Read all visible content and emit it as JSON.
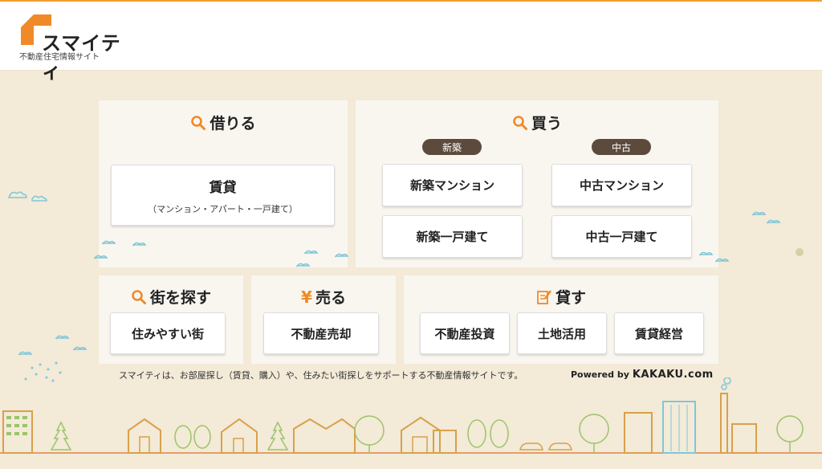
{
  "header": {
    "logo_name": "スマイティ",
    "logo_sub": "不動産住宅情報サイト"
  },
  "rent": {
    "title": "借りる",
    "button_label": "賃貸",
    "button_sub": "（マンション・アパート・一戸建て）"
  },
  "buy": {
    "title": "買う",
    "new_pill": "新築",
    "used_pill": "中古",
    "new_mansion": "新築マンション",
    "new_house": "新築一戸建て",
    "used_mansion": "中古マンション",
    "used_house": "中古一戸建て"
  },
  "town": {
    "title": "街を探す",
    "button": "住みやすい街"
  },
  "sell": {
    "title": "売る",
    "icon_glyph": "¥",
    "button": "不動産売却"
  },
  "lend": {
    "title": "貸す",
    "invest": "不動産投資",
    "land": "土地活用",
    "manage": "賃貸経営"
  },
  "footer": {
    "description": "スマイティは、お部屋探し（賃貸、購入）や、住みたい街探しをサポートする不動産情報サイトです。",
    "powered_by": "Powered by",
    "brand": "KAKAKU.com"
  },
  "colors": {
    "accent": "#f08a28",
    "background": "#f3ead7",
    "panel": "#f9f6f0",
    "pill": "#5c4b3d"
  }
}
